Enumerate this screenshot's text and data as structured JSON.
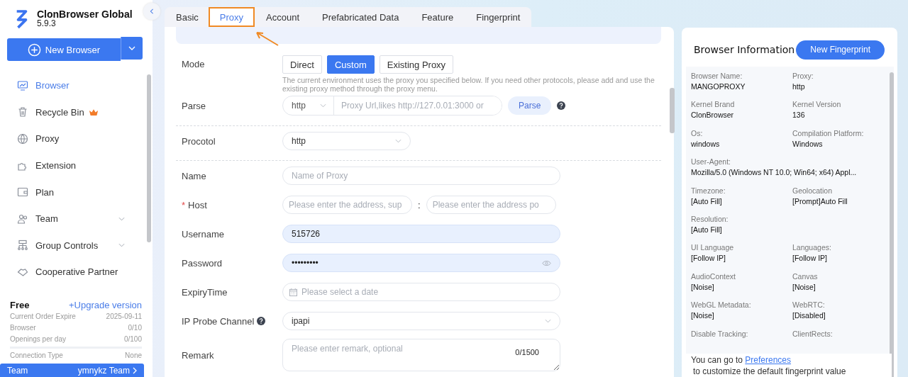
{
  "app": {
    "name": "ClonBrowser Global",
    "version": "5.9.3"
  },
  "new_browser": {
    "label": "New Browser"
  },
  "sidebar": {
    "items": [
      {
        "label": "Browser",
        "selected": true
      },
      {
        "label": "Recycle Bin",
        "selected": false,
        "premium": true
      },
      {
        "label": "Proxy",
        "selected": false
      },
      {
        "label": "Extension",
        "selected": false
      },
      {
        "label": "Plan",
        "selected": false
      },
      {
        "label": "Team",
        "selected": false,
        "expanded": false
      },
      {
        "label": "Group Controls",
        "selected": false,
        "expanded": false
      },
      {
        "label": "Cooperative Partner",
        "selected": false
      }
    ]
  },
  "plan": {
    "name": "Free",
    "upgrade": "+Upgrade version",
    "rows": [
      {
        "label": "Current Order Expire",
        "value": "2025-09-11"
      },
      {
        "label": "Browser",
        "value": "0/10"
      },
      {
        "label": "Openings per day",
        "value": "0/100"
      }
    ],
    "connection": {
      "label": "Connection Type",
      "value": "None"
    },
    "team": {
      "label": "Team",
      "value": "ymnykz Team"
    }
  },
  "tabs": [
    {
      "label": "Basic",
      "selected": false,
      "highlighted": false
    },
    {
      "label": "Proxy",
      "selected": true,
      "highlighted": true
    },
    {
      "label": "Account",
      "selected": false,
      "highlighted": false
    },
    {
      "label": "Prefabricated Data",
      "selected": false,
      "highlighted": false
    },
    {
      "label": "Feature",
      "selected": false,
      "highlighted": false
    },
    {
      "label": "Fingerprint",
      "selected": false,
      "highlighted": false
    }
  ],
  "form": {
    "mode": {
      "label": "Mode",
      "options": [
        {
          "label": "Direct",
          "selected": false
        },
        {
          "label": "Custom",
          "selected": true
        },
        {
          "label": "Existing Proxy",
          "selected": false
        }
      ],
      "hint": "The current environment uses the proxy you specified below. If you need other protocols, please add and use the existing proxy method through the proxy menu."
    },
    "parse": {
      "label": "Parse",
      "protocol": "http",
      "placeholder": "Proxy Url,likes http://127.0.01:3000 or",
      "button": "Parse"
    },
    "protocol": {
      "label": "Procotol",
      "value": "http"
    },
    "fields": [
      {
        "kind": "input",
        "label": "Name",
        "placeholder": "Name of Proxy"
      },
      {
        "kind": "host",
        "label": "Host",
        "required_mark": "*",
        "placeholder": "Please enter the address, sup",
        "port_placeholder": "Please enter the address po",
        "separator": ":"
      },
      {
        "kind": "input",
        "label": "Username",
        "value": "515726"
      },
      {
        "kind": "password",
        "label": "Password",
        "value": "•••••••••"
      },
      {
        "kind": "date",
        "label": "ExpiryTime",
        "placeholder": "Please select a date"
      },
      {
        "kind": "select",
        "label": "IP Probe Channel",
        "value": "ipapi",
        "help": true
      },
      {
        "kind": "textarea",
        "label": "Remark",
        "placeholder": "Please enter remark, optional",
        "counter": "0/1500"
      }
    ]
  },
  "info": {
    "title": "Browser Information",
    "button": "New Fingerprint",
    "rows": [
      [
        {
          "label": "Browser Name:",
          "value": "MANGOPROXY"
        },
        {
          "label": "Proxy:",
          "value": "http"
        }
      ],
      [
        {
          "label": "Kernel Brand",
          "value": "ClonBrowser"
        },
        {
          "label": "Kernel Version",
          "value": "136"
        }
      ],
      [
        {
          "label": "Os:",
          "value": "windows"
        },
        {
          "label": "Compilation Platform:",
          "value": "Windows"
        }
      ],
      [
        {
          "label": "User-Agent:",
          "value": "Mozilla/5.0 (Windows NT 10.0; Win64; x64) Appl..."
        }
      ],
      [
        {
          "label": "Timezone:",
          "value": "[Auto Fill]"
        },
        {
          "label": "Geolocation",
          "value": "[Prompt]Auto Fill"
        }
      ],
      [
        {
          "label": "Resolution:",
          "value": "[Auto Fill]"
        }
      ],
      [
        {
          "label": "UI Language",
          "value": "[Follow IP]"
        },
        {
          "label": "Languages:",
          "value": "[Follow IP]"
        }
      ],
      [
        {
          "label": "AudioContext",
          "value": "[Noise]"
        },
        {
          "label": "Canvas",
          "value": "[Noise]"
        }
      ],
      [
        {
          "label": "WebGL Metadata:",
          "value": "[Noise]"
        },
        {
          "label": "WebRTC:",
          "value": "[Disabled]"
        }
      ],
      [
        {
          "label": "Disable Tracking:"
        },
        {
          "label": "ClientRects:"
        }
      ]
    ],
    "footer": {
      "before": "You can go to",
      "link": "Preferences",
      "after": "to customize the default fingerprint value"
    }
  }
}
